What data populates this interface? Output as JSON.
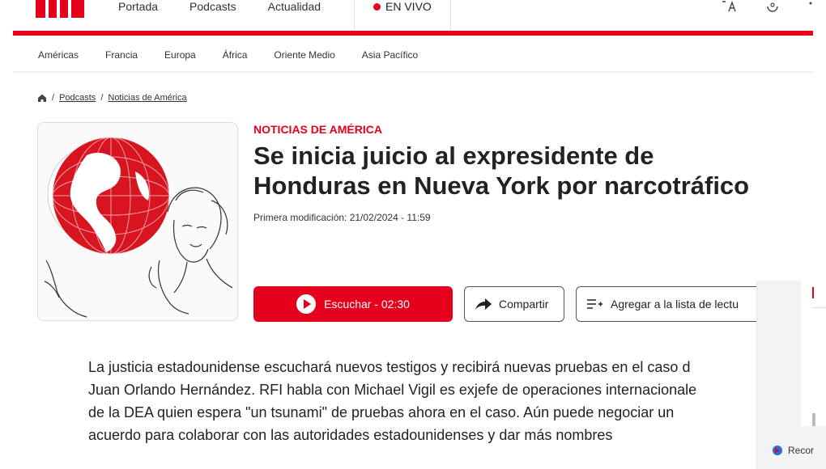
{
  "header": {
    "nav": [
      "Portada",
      "Podcasts",
      "Actualidad"
    ],
    "live_label": "EN VIVO",
    "colors": {
      "brand": "#e5001b"
    }
  },
  "regions": [
    "Américas",
    "Francia",
    "Europa",
    "África",
    "Oriente Medio",
    "Asia Pacífico"
  ],
  "breadcrumb": {
    "items": [
      "Podcasts",
      "Noticias de América"
    ]
  },
  "article": {
    "kicker": "NOTICIAS DE AMÉRICA",
    "title_line1": "Se inicia juicio al expresidente de",
    "title_line2": "Honduras en Nueva York por narcotráfico",
    "modified": "Primera modificación: 21/02/2024 - 11:59",
    "lead": [
      "La justicia estadounidense escuchará nuevos testigos y recibirá nuevas pruebas en el caso d",
      "Juan Orlando Hernández. RFI habla con Michael Vigil es exjefe de operaciones internacionale",
      "de la DEA quien espera \"un tsunami\" de pruebas ahora en el caso. Aún puede negociar un",
      "acuerdo para colaborar con las autoridades estadounidenses y dar más nombres"
    ]
  },
  "actions": {
    "listen": "Escuchar - 02:30",
    "share": "Compartir",
    "read_list": "Agregar a la lista de lectu"
  },
  "overlay": {
    "label": "Recor"
  }
}
